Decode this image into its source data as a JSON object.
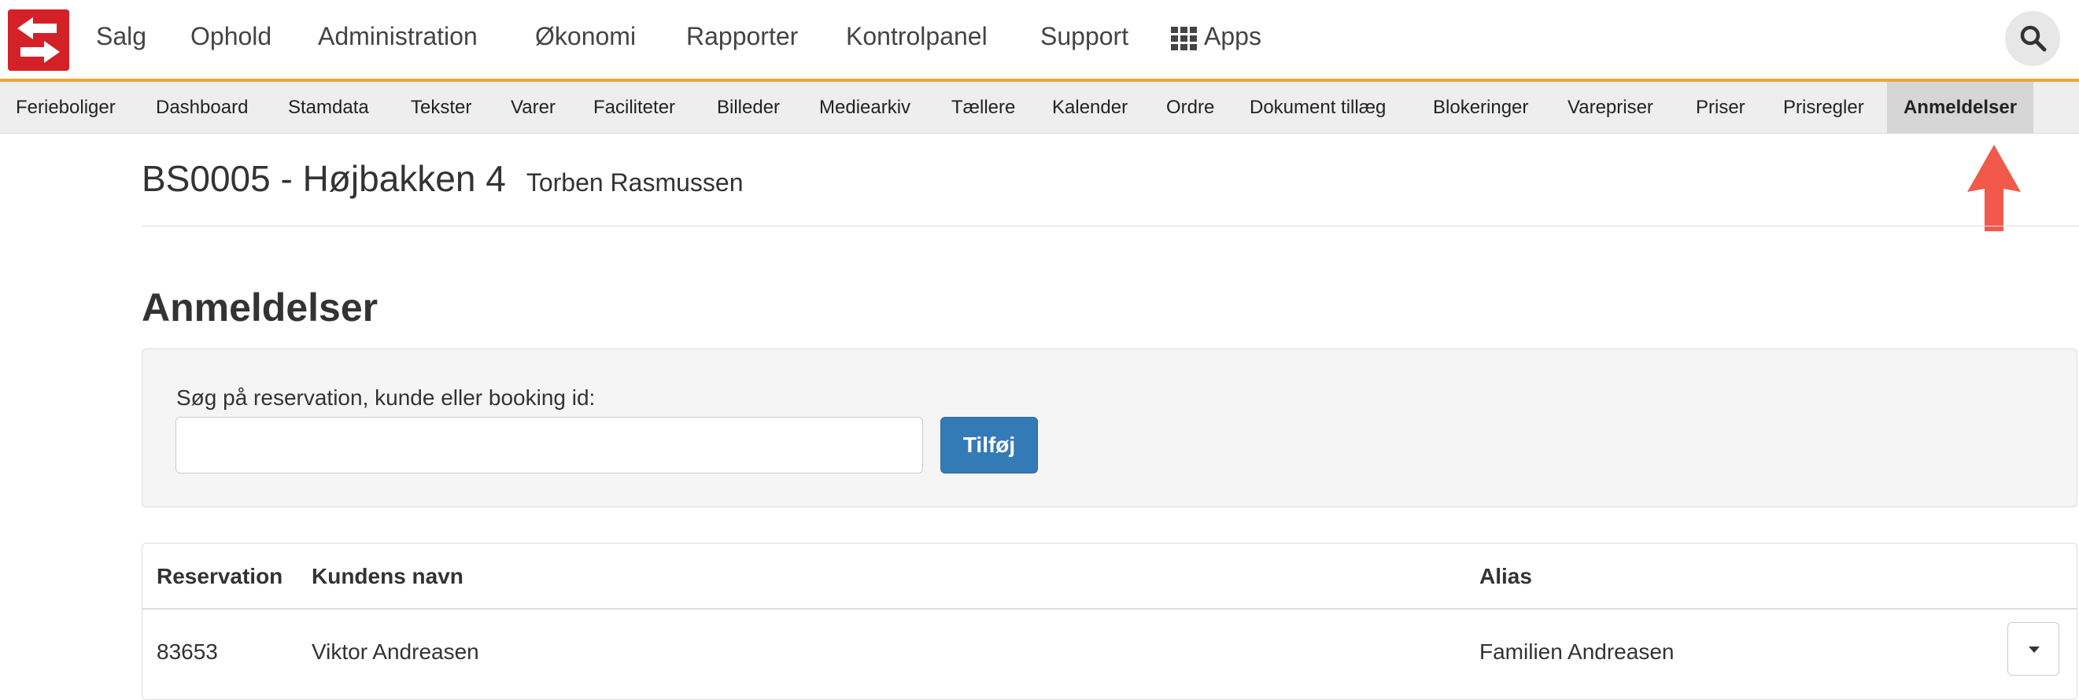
{
  "topnav": {
    "items": [
      "Salg",
      "Ophold",
      "Administration",
      "Økonomi",
      "Rapporter",
      "Kontrolpanel",
      "Support"
    ],
    "apps_label": "Apps"
  },
  "subnav": {
    "items": [
      "Ferieboliger",
      "Dashboard",
      "Stamdata",
      "Tekster",
      "Varer",
      "Faciliteter",
      "Billeder",
      "Mediearkiv",
      "Tællere",
      "Kalender",
      "Ordre",
      "Dokument tillæg",
      "Blokeringer",
      "Varepriser",
      "Priser",
      "Prisregler",
      "Anmeldelser"
    ],
    "active": "Anmeldelser"
  },
  "page": {
    "title": "BS0005 - Højbakken 4",
    "owner": "Torben Rasmussen",
    "section_title": "Anmeldelser"
  },
  "search": {
    "label": "Søg på reservation, kunde eller booking id:",
    "value": "",
    "button_label": "Tilføj"
  },
  "table": {
    "headers": [
      "Reservation",
      "Kundens navn",
      "Alias"
    ],
    "rows": [
      {
        "reservation": "83653",
        "customer": "Viktor Andreasen",
        "alias": "Familien Andreasen"
      }
    ]
  },
  "colors": {
    "brand_red": "#d42027",
    "accent_orange": "#f2a43a",
    "primary_blue": "#337ab7",
    "arrow_red": "#f15a4a"
  }
}
